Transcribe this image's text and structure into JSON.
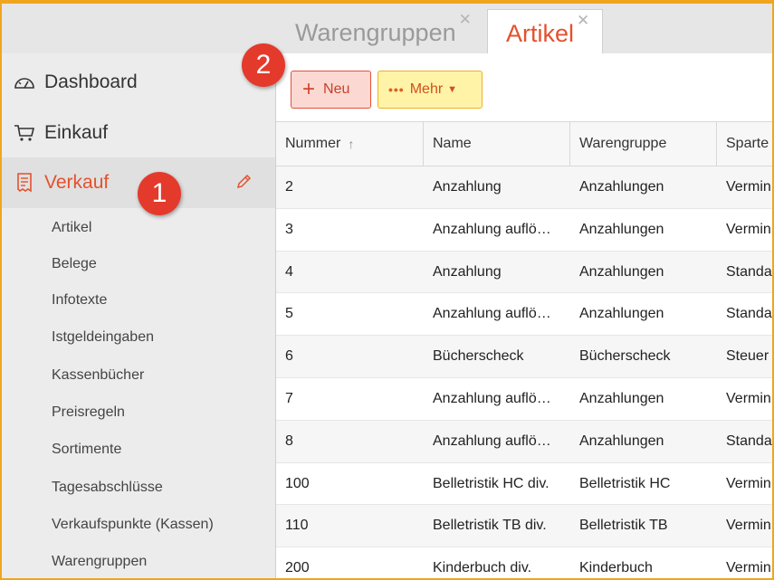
{
  "tabs": [
    {
      "label": "Warengruppen",
      "close": "✕"
    },
    {
      "label": "Artikel",
      "close": "✕"
    }
  ],
  "sidebar": {
    "main_items": [
      {
        "label": "Dashboard",
        "icon": "dashboard-icon"
      },
      {
        "label": "Einkauf",
        "icon": "cart-icon"
      },
      {
        "label": "Verkauf",
        "icon": "receipt-icon"
      }
    ],
    "sub_items": [
      "Artikel",
      "Belege",
      "Infotexte",
      "Istgeldeingaben",
      "Kassenbücher",
      "Preisregeln",
      "Sortimente",
      "Tagesabschlüsse",
      "Verkaufspunkte (Kassen)",
      "Warengruppen"
    ]
  },
  "badges": {
    "one": "1",
    "two": "2"
  },
  "toolbar": {
    "new_label": "Neu",
    "new_icon": "+",
    "more_label": "Mehr",
    "more_dots": "•••",
    "more_caret": "▼"
  },
  "table": {
    "columns": [
      "Nummer",
      "Name",
      "Warengruppe",
      "Sparte"
    ],
    "sort_indicator": "↑",
    "rows": [
      {
        "nummer": "2",
        "name": "Anzahlung",
        "warengruppe": "Anzahlungen",
        "sparte": "Vermin"
      },
      {
        "nummer": "3",
        "name": "Anzahlung auflö…",
        "warengruppe": "Anzahlungen",
        "sparte": "Vermin"
      },
      {
        "nummer": "4",
        "name": "Anzahlung",
        "warengruppe": "Anzahlungen",
        "sparte": "Standa"
      },
      {
        "nummer": "5",
        "name": "Anzahlung auflö…",
        "warengruppe": "Anzahlungen",
        "sparte": "Standa"
      },
      {
        "nummer": "6",
        "name": "Bücherscheck",
        "warengruppe": "Bücherscheck",
        "sparte": "Steuer"
      },
      {
        "nummer": "7",
        "name": "Anzahlung auflö…",
        "warengruppe": "Anzahlungen",
        "sparte": "Vermin"
      },
      {
        "nummer": "8",
        "name": "Anzahlung auflö…",
        "warengruppe": "Anzahlungen",
        "sparte": "Standa"
      },
      {
        "nummer": "100",
        "name": "Belletristik HC div.",
        "warengruppe": "Belletristik HC",
        "sparte": "Vermin"
      },
      {
        "nummer": "110",
        "name": "Belletristik TB div.",
        "warengruppe": "Belletristik TB",
        "sparte": "Vermin"
      },
      {
        "nummer": "200",
        "name": "Kinderbuch div.",
        "warengruppe": "Kinderbuch",
        "sparte": "Vermin"
      }
    ]
  },
  "colors": {
    "accent": "#e4512e",
    "badge": "#e43a2c",
    "frame": "#f0a520"
  }
}
